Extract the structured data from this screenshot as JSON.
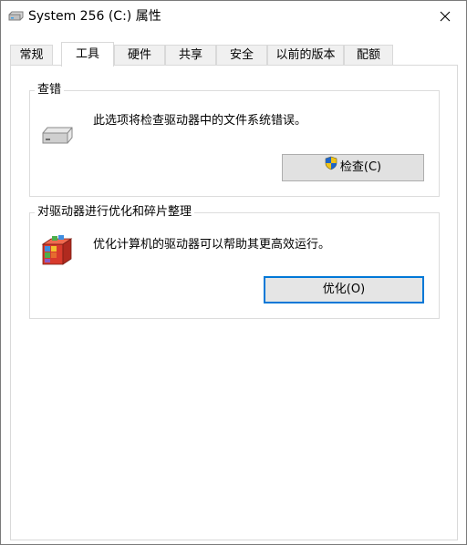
{
  "window": {
    "title": "System 256 (C:) 属性"
  },
  "tabs": [
    {
      "label": "常规",
      "active": false
    },
    {
      "label": "工具",
      "active": true
    },
    {
      "label": "硬件",
      "active": false
    },
    {
      "label": "共享",
      "active": false
    },
    {
      "label": "安全",
      "active": false
    },
    {
      "label": "以前的版本",
      "active": false
    },
    {
      "label": "配额",
      "active": false
    }
  ],
  "error_check": {
    "legend": "查错",
    "description": "此选项将检查驱动器中的文件系统错误。",
    "button_label": "检查(C)",
    "icon": "drive-icon",
    "button_icon": "uac-shield-icon"
  },
  "optimize": {
    "legend": "对驱动器进行优化和碎片整理",
    "description": "优化计算机的驱动器可以帮助其更高效运行。",
    "button_label": "优化(O)",
    "icon": "defrag-icon"
  },
  "colors": {
    "focus_border": "#0078d7",
    "button_bg": "#e1e1e1"
  }
}
